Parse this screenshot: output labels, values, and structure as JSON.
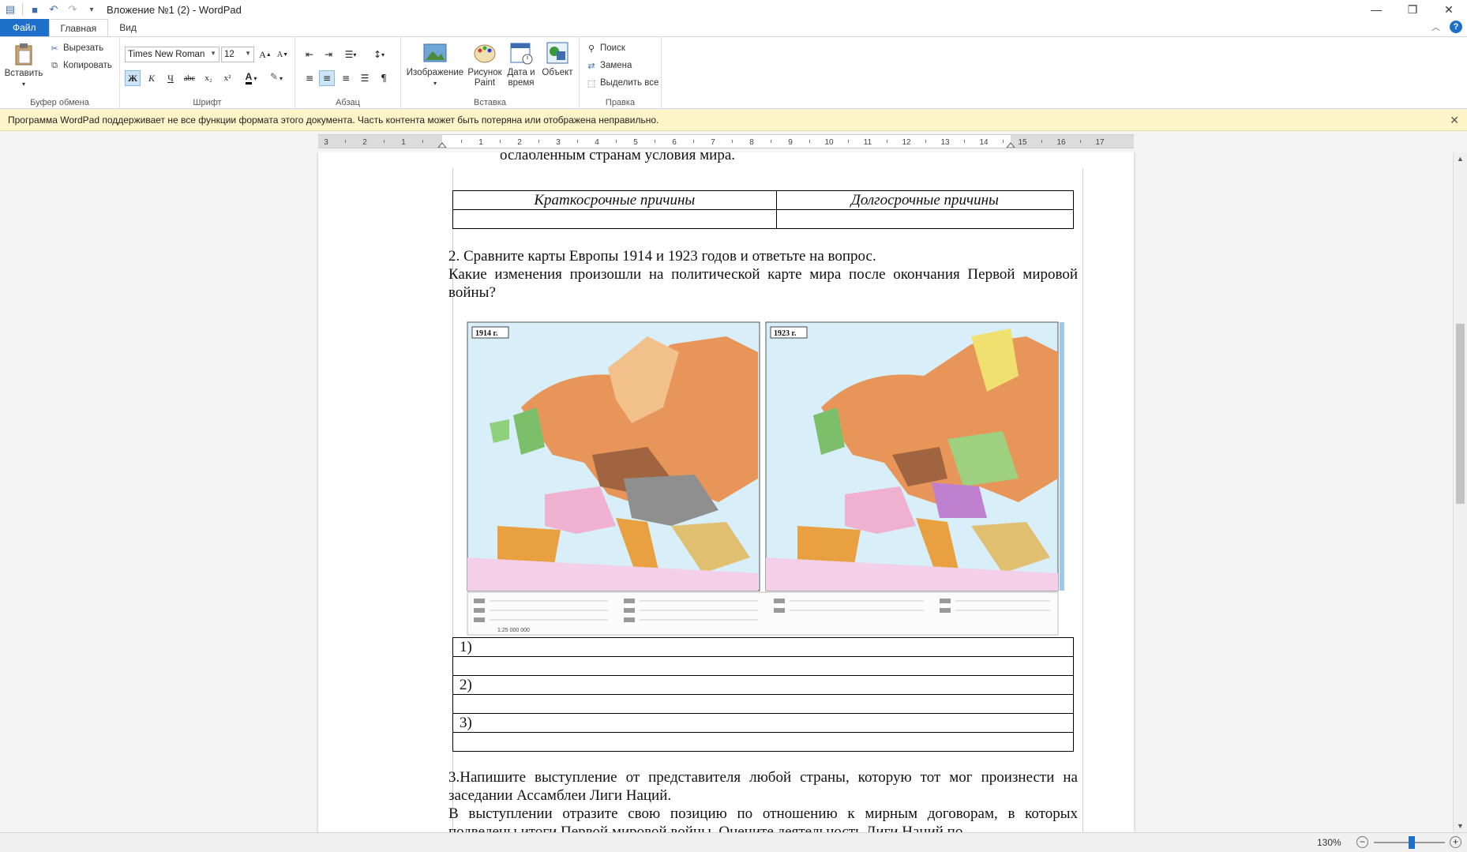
{
  "window": {
    "title": "Вложение №1 (2) - WordPad"
  },
  "ribbon_tabs": [
    "Файл",
    "Главная",
    "Вид"
  ],
  "clipboard": {
    "paste": "Вставить",
    "cut": "Вырезать",
    "copy": "Копировать",
    "label": "Буфер обмена"
  },
  "font": {
    "family": "Times New Roman",
    "size": "12",
    "bold": "Ж",
    "italic": "К",
    "underline": "Ч",
    "strike": "abc",
    "sub": "x₂",
    "sup": "x²",
    "label": "Шрифт"
  },
  "paragraph": {
    "label": "Абзац"
  },
  "insert": {
    "image": "Изображение",
    "paint_line1": "Рисунок",
    "paint_line2": "Paint",
    "datetime_line1": "Дата и",
    "datetime_line2": "время",
    "object": "Объект",
    "label": "Вставка"
  },
  "editing": {
    "find": "Поиск",
    "replace": "Замена",
    "select_all": "Выделить все",
    "label": "Правка"
  },
  "warning": "Программа WordPad поддерживает не все функции формата этого документа. Часть контента может быть потеряна или отображена неправильно.",
  "ruler": {
    "ticks": [
      "3",
      "2",
      "1",
      "1",
      "2",
      "3",
      "4",
      "5",
      "6",
      "7",
      "8",
      "9",
      "10",
      "11",
      "12",
      "13",
      "14",
      "15",
      "16",
      "17"
    ]
  },
  "document": {
    "prev_line": "ослабленным странам условия мира.",
    "table_headers": [
      "Краткосрочные причины",
      "Долгосрочные причины"
    ],
    "q2_line1": "2. Сравните карты Европы 1914 и 1923 годов и ответьте на вопрос.",
    "q2_line2": "Какие изменения произошли на политической карте мира после окончания Первой мировой войны?",
    "map_labels": [
      "1914 г.",
      "1923 г."
    ],
    "map_scale": "1:25 000 000",
    "answers": [
      "1)",
      "2)",
      "3)"
    ],
    "q3_line1": "3.Напишите выступление от представителя любой страны, которую тот мог произнести на заседании Ассамблеи Лиги Наций.",
    "q3_line2": "В выступлении отразите свою позицию по отношению к мирным договорам, в которых подведены итоги Первой мировой войны. Оцените деятельность Лиги Наций по"
  },
  "status": {
    "zoom": "130%"
  },
  "colors": {
    "file_tab": "#1e6fc9",
    "warning_bg": "#fdf4c7"
  }
}
